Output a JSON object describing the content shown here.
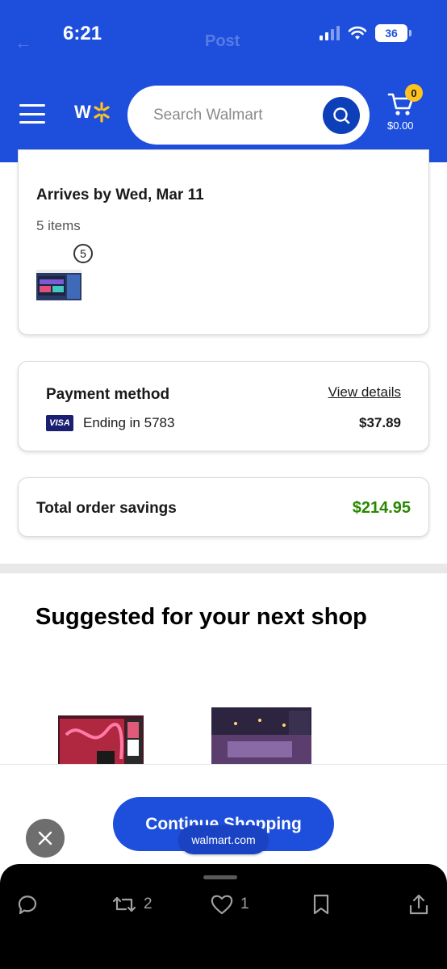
{
  "status_bar": {
    "time": "6:21",
    "battery": "36"
  },
  "nav_ghost": {
    "back": "←",
    "title": "Post"
  },
  "header": {
    "logo_text": "W",
    "search_placeholder": "Search Walmart",
    "cart_count": "0",
    "cart_total": "$0.00"
  },
  "order": {
    "arrives": "Arrives by Wed, Mar 11",
    "items": "5 items",
    "qty": "5"
  },
  "payment": {
    "title": "Payment method",
    "link": "View details",
    "card_brand": "VISA",
    "ending": "Ending in 5783",
    "amount": "$37.89"
  },
  "savings": {
    "label": "Total order savings",
    "amount": "$214.95"
  },
  "suggested": {
    "title": "Suggested for your next shop"
  },
  "cta": {
    "label": "Continue Shopping"
  },
  "browser": {
    "url": "walmart.com"
  },
  "actions": {
    "retweets": "2",
    "likes": "1"
  },
  "colors": {
    "brand_blue": "#1e4fdc",
    "spark_yellow": "#ffc220",
    "savings_green": "#2a8703"
  }
}
